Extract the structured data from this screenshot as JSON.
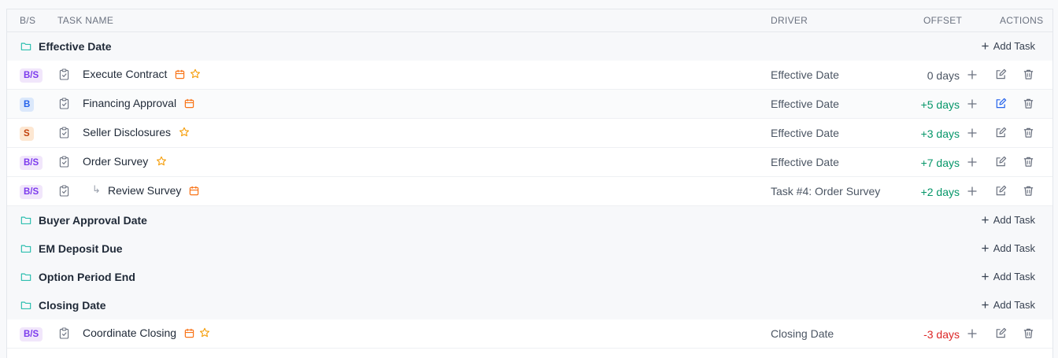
{
  "headers": {
    "bs": "B/S",
    "task_name": "TASK NAME",
    "driver": "DRIVER",
    "offset": "OFFSET",
    "actions": "ACTIONS"
  },
  "add_task_label": "Add Task",
  "colors": {
    "folder": "#14b8a6",
    "calendar": "#f97316",
    "star": "#f59e0b",
    "offset_positive": "#059669",
    "offset_negative": "#dc2626",
    "edit_active": "#2563eb"
  },
  "groups": [
    {
      "title": "Effective Date"
    },
    {
      "title": "Buyer Approval Date"
    },
    {
      "title": "EM Deposit Due"
    },
    {
      "title": "Option Period End"
    },
    {
      "title": "Closing Date"
    }
  ],
  "tasks": [
    {
      "badge": "B/S",
      "name": "Execute Contract",
      "driver": "Effective Date",
      "offset": "0 days",
      "icons": [
        "calendar-icon",
        "star-icon"
      ]
    },
    {
      "badge": "B",
      "name": "Financing Approval",
      "driver": "Effective Date",
      "offset": "+5 days",
      "icons": [
        "calendar-icon"
      ],
      "edit_active": true
    },
    {
      "badge": "S",
      "name": "Seller Disclosures",
      "driver": "Effective Date",
      "offset": "+3 days",
      "icons": [
        "star-icon"
      ]
    },
    {
      "badge": "B/S",
      "name": "Order Survey",
      "driver": "Effective Date",
      "offset": "+7 days",
      "icons": [
        "star-icon"
      ]
    },
    {
      "badge": "B/S",
      "name": "Review Survey",
      "driver": "Task #4: Order Survey",
      "offset": "+2 days",
      "icons": [
        "calendar-icon"
      ],
      "subtask": true,
      "subtask_arrow": "↳"
    },
    {
      "badge": "B/S",
      "name": "Coordinate Closing",
      "driver": "Closing Date",
      "offset": "-3 days",
      "icons": [
        "calendar-icon",
        "star-icon"
      ]
    }
  ]
}
